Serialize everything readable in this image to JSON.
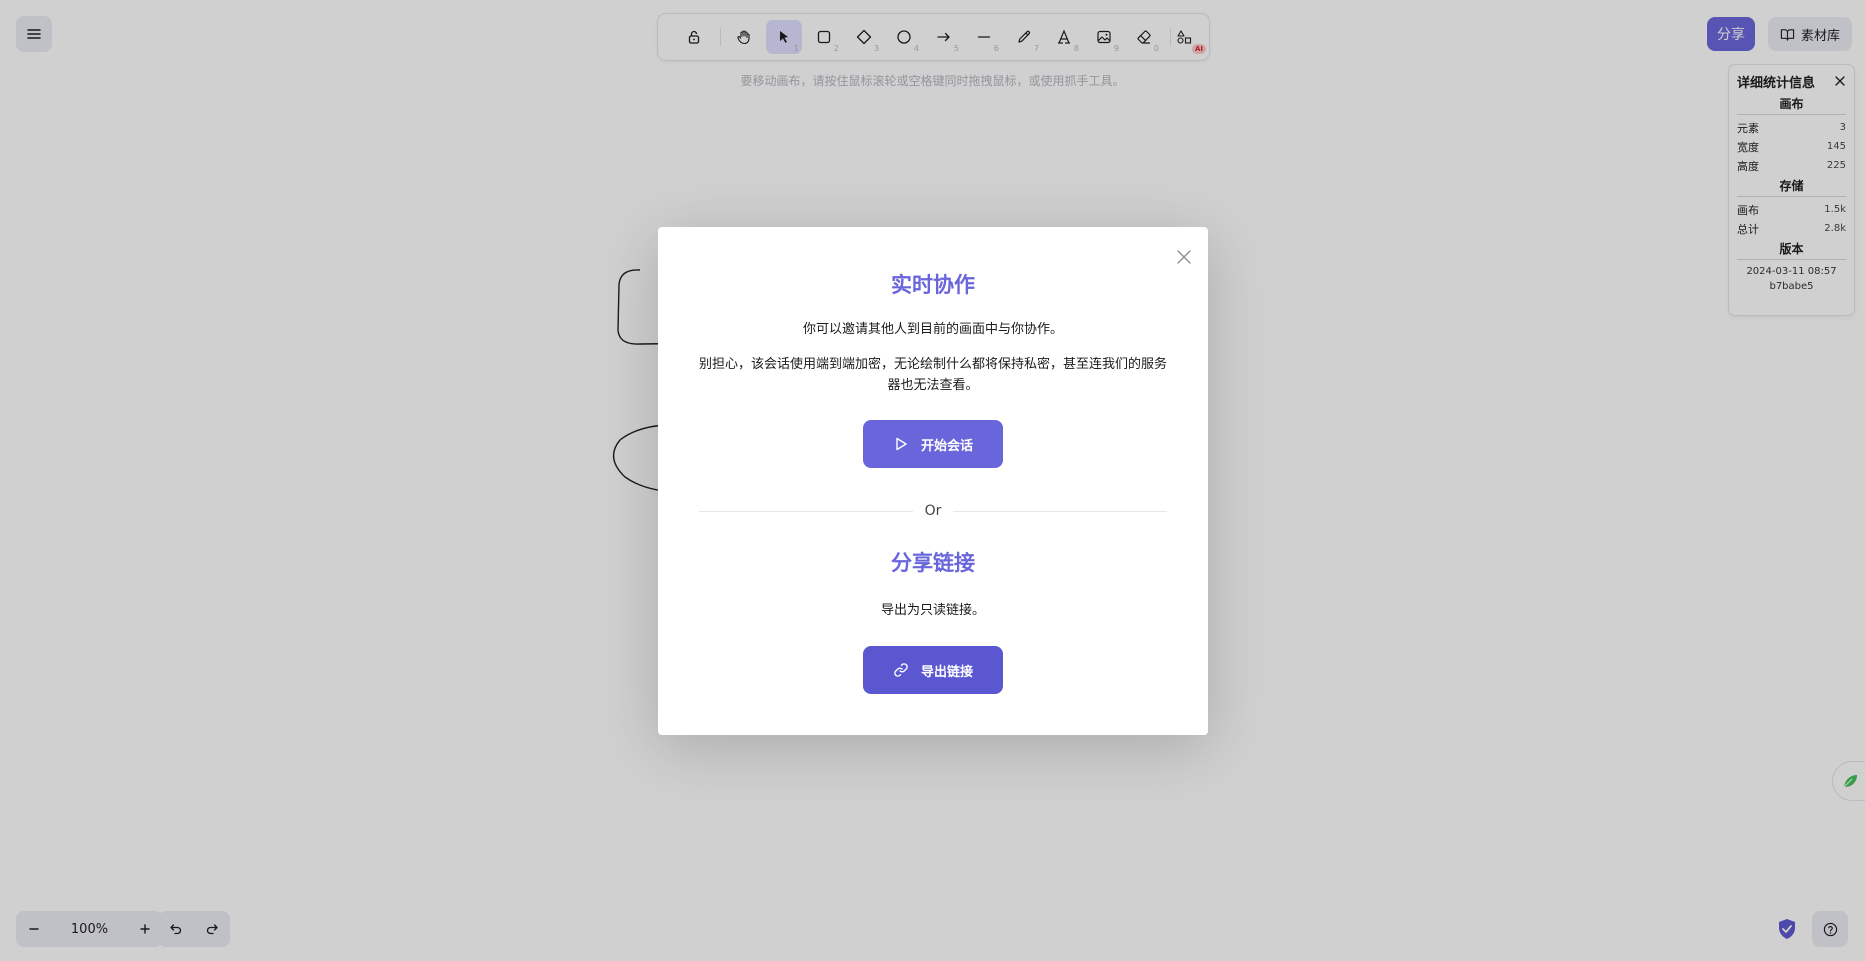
{
  "toolbar": {
    "tools": [
      {
        "name": "lock",
        "num": ""
      },
      {
        "name": "hand",
        "num": ""
      },
      {
        "name": "selection",
        "num": "1"
      },
      {
        "name": "rectangle",
        "num": "2"
      },
      {
        "name": "diamond",
        "num": "3"
      },
      {
        "name": "ellipse",
        "num": "4"
      },
      {
        "name": "arrow",
        "num": "5"
      },
      {
        "name": "line",
        "num": "6"
      },
      {
        "name": "draw",
        "num": "7"
      },
      {
        "name": "text",
        "num": "8"
      },
      {
        "name": "image",
        "num": "9"
      },
      {
        "name": "eraser",
        "num": "0"
      }
    ],
    "ai_badge": "AI"
  },
  "hint": "要移动画布，请按住鼠标滚轮或空格键同时拖拽鼠标，或使用抓手工具。",
  "share_label": "分享",
  "library_label": "素材库",
  "stats": {
    "title": "详细统计信息",
    "canvas_section": "画布",
    "elements_label": "元素",
    "elements_value": "3",
    "width_label": "宽度",
    "width_value": "145",
    "height_label": "高度",
    "height_value": "225",
    "storage_section": "存储",
    "storage_canvas_label": "画布",
    "storage_canvas_value": "1.5k",
    "storage_total_label": "总计",
    "storage_total_value": "2.8k",
    "version_section": "版本",
    "version_date": "2024-03-11 08:57",
    "version_hash": "b7babe5"
  },
  "zoom": {
    "level": "100%"
  },
  "modal": {
    "collab_title": "实时协作",
    "collab_desc1": "你可以邀请其他人到目前的画面中与你协作。",
    "collab_desc2": "别担心，该会话使用端到端加密，无论绘制什么都将保持私密，甚至连我们的服务器也无法查看。",
    "start_session_label": "开始会话",
    "or_label": "Or",
    "share_link_title": "分享链接",
    "share_link_desc": "导出为只读链接。",
    "export_link_label": "导出链接"
  },
  "colors": {
    "accent": "#6965db",
    "accent_dark": "#5b57d1",
    "island": "#ececf4"
  }
}
